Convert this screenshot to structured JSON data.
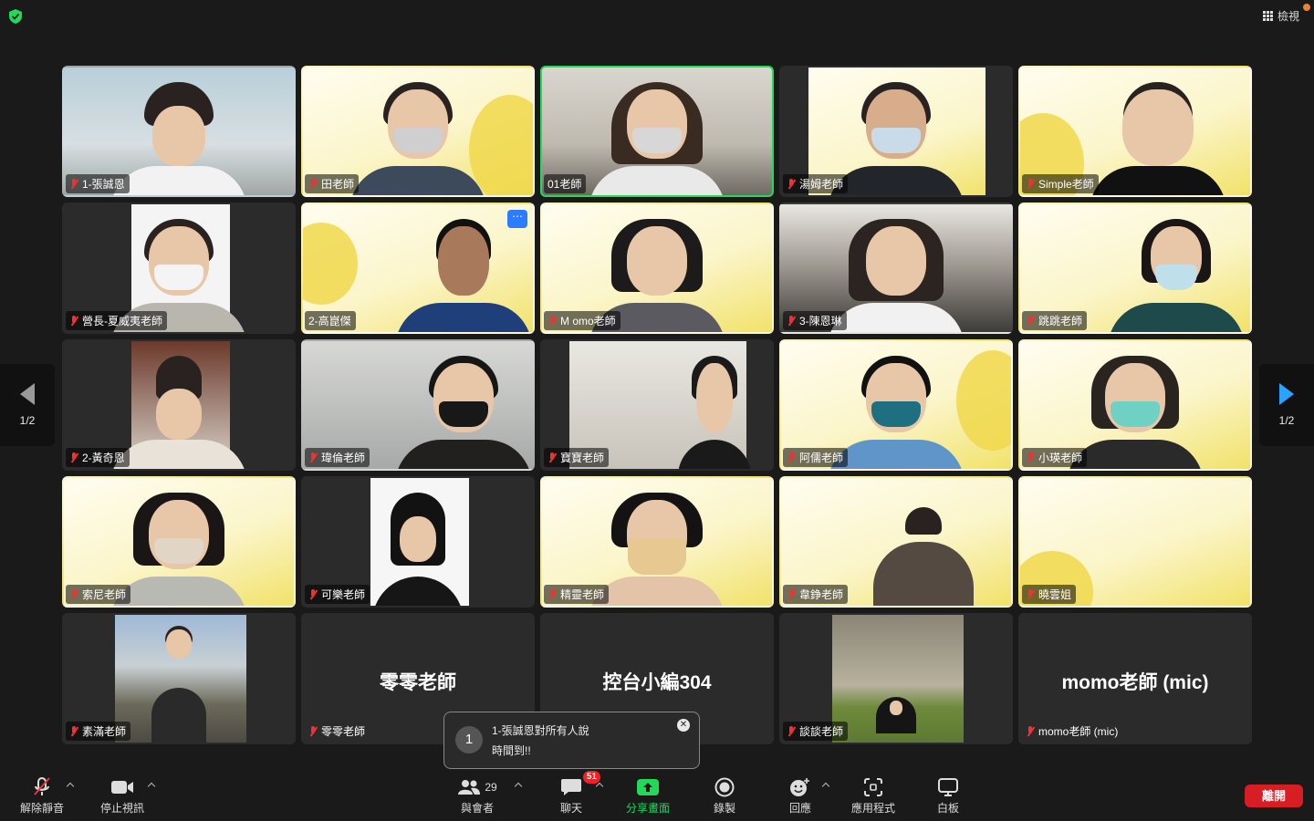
{
  "topbar": {
    "view_label": "檢視"
  },
  "pager": {
    "left_label": "1/2",
    "right_label": "1/2"
  },
  "tiles": [
    {
      "name": "1-張誠恩",
      "type": "video"
    },
    {
      "name": "田老師",
      "type": "video"
    },
    {
      "name": "01老師",
      "type": "video",
      "active": true
    },
    {
      "name": "湯姆老師",
      "type": "video"
    },
    {
      "name": "Simple老師",
      "type": "video"
    },
    {
      "name": "營長-夏威夷老師",
      "type": "video"
    },
    {
      "name": "2-高崑傑",
      "type": "video"
    },
    {
      "name": "M omo老師",
      "type": "video"
    },
    {
      "name": "3-陳恩琳",
      "type": "video"
    },
    {
      "name": "跳跳老師",
      "type": "video"
    },
    {
      "name": "2-黃奇恩",
      "type": "video"
    },
    {
      "name": "瑋倫老師",
      "type": "video"
    },
    {
      "name": "寶寶老師",
      "type": "video"
    },
    {
      "name": "阿儒老師",
      "type": "video"
    },
    {
      "name": "小瑛老師",
      "type": "video"
    },
    {
      "name": "索尼老師",
      "type": "video"
    },
    {
      "name": "可樂老師",
      "type": "video"
    },
    {
      "name": "精靈老師",
      "type": "video"
    },
    {
      "name": "韋錚老師",
      "type": "video"
    },
    {
      "name": "曉雲姐",
      "type": "video"
    },
    {
      "name": "素滿老師",
      "type": "video"
    },
    {
      "name": "零零老師",
      "type": "name-only",
      "big_name": "零零老師"
    },
    {
      "name": "",
      "type": "name-only",
      "big_name": "控台小編304"
    },
    {
      "name": "談談老師",
      "type": "video"
    },
    {
      "name": "momo老師 (mic)",
      "type": "name-only",
      "big_name": "momo老師 (mic)"
    }
  ],
  "toast": {
    "count": "1",
    "sender": "1-張誠恩對所有人說",
    "message": "時間到!!"
  },
  "toolbar": {
    "unmute": "解除靜音",
    "stop_video": "停止視訊",
    "participants": "與會者",
    "participant_count": "29",
    "chat": "聊天",
    "chat_badge": "51",
    "share": "分享畫面",
    "record": "錄製",
    "reactions": "回應",
    "apps": "應用程式",
    "whiteboard": "白板",
    "leave": "離開"
  },
  "self_preview": {
    "indicator": "$"
  },
  "colors": {
    "active_border": "#23d959",
    "leave": "#d81e24",
    "share": "#23d959",
    "badge": "#e22222"
  }
}
